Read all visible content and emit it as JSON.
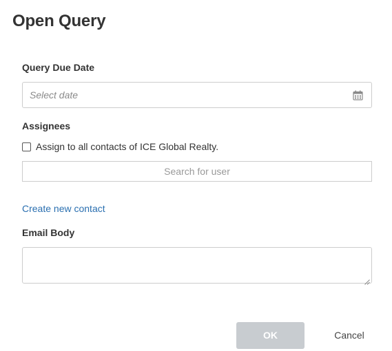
{
  "dialog": {
    "title": "Open Query"
  },
  "due_date": {
    "label": "Query Due Date",
    "placeholder": "Select date",
    "icon": "calendar-icon"
  },
  "assignees": {
    "label": "Assignees",
    "assign_all_label": "Assign to all contacts of ICE Global Realty.",
    "assign_all_checked": false,
    "search_placeholder": "Search for user",
    "create_contact_link": "Create new contact"
  },
  "email_body": {
    "label": "Email Body",
    "value": ""
  },
  "actions": {
    "ok_label": "OK",
    "cancel_label": "Cancel"
  },
  "colors": {
    "link": "#2a6fb0",
    "ok_disabled_bg": "#c8ccd0",
    "border": "#cccccc"
  }
}
